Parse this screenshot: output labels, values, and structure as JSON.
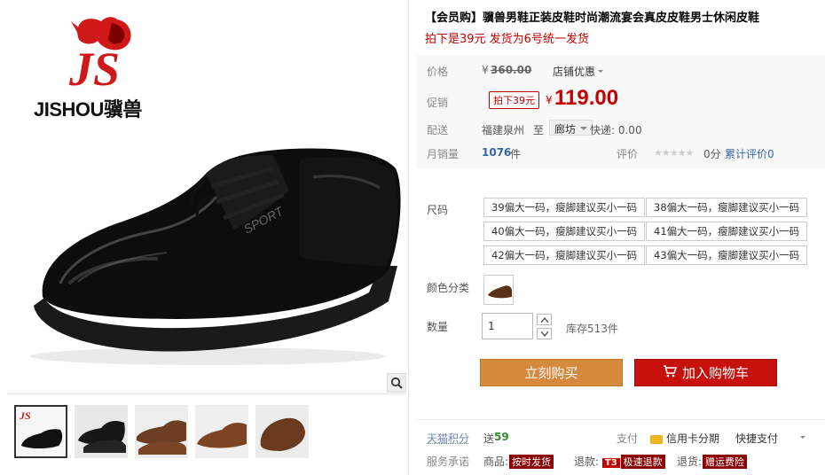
{
  "brand": {
    "logo_latin": "JISHOU",
    "logo_cn": "骥兽",
    "logo_mark": "JS"
  },
  "product": {
    "title": "【会员购】骥兽男鞋正装皮鞋时尚潮流宴会真皮皮鞋男士休闲皮鞋",
    "subtitle": "拍下是39元 发货为6号统一发货"
  },
  "price": {
    "label": "价格",
    "yen": "¥",
    "original": "360.00",
    "shop_discount": "店铺优惠"
  },
  "promo": {
    "label": "促销",
    "tag": "拍下39元",
    "yen": "¥",
    "value": "119.00"
  },
  "delivery": {
    "label": "配送",
    "from": "福建泉州",
    "to_word": "至",
    "to_city": "廊坊",
    "express": "快递: 0.00"
  },
  "sales": {
    "label": "月销量",
    "count": "1076",
    "unit": "件",
    "review_label": "评价",
    "score": "0分",
    "review_link": "累计评价0"
  },
  "sizes": {
    "label": "尺码",
    "options": [
      "39偏大一码，瘦脚建议买小一码",
      "38偏大一码，瘦脚建议买小一码",
      "40偏大一码，瘦脚建议买小一码",
      "41偏大一码，瘦脚建议买小一码",
      "42偏大一码，瘦脚建议买小一码",
      "43偏大一码，瘦脚建议买小一码"
    ]
  },
  "color": {
    "label": "颜色分类"
  },
  "quantity": {
    "label": "数量",
    "value": "1",
    "stock": "库存513件"
  },
  "actions": {
    "buy_now": "立刻购买",
    "add_to_cart": "加入购物车"
  },
  "points": {
    "label": "天猫积分",
    "value_prefix": "送",
    "value": "59"
  },
  "payment": {
    "label": "支付",
    "credit": "信用卡分期",
    "express_pay": "快捷支付"
  },
  "service": {
    "label": "服务承诺",
    "goods_label": "商品:",
    "goods_tag": "按时发货",
    "refund_label": "退款:",
    "refund_t3": "T3",
    "refund_tag": "极速退款",
    "return_label": "退货:",
    "return_tag": "赠运费险"
  },
  "colors": {
    "accent_red": "#c40000",
    "buy_now_orange": "#d68a3e",
    "cart_red": "#c8100d"
  },
  "icons": [
    "zoom-icon",
    "cart-icon",
    "credit-card-icon",
    "chevron-down-icon",
    "star-icon"
  ]
}
